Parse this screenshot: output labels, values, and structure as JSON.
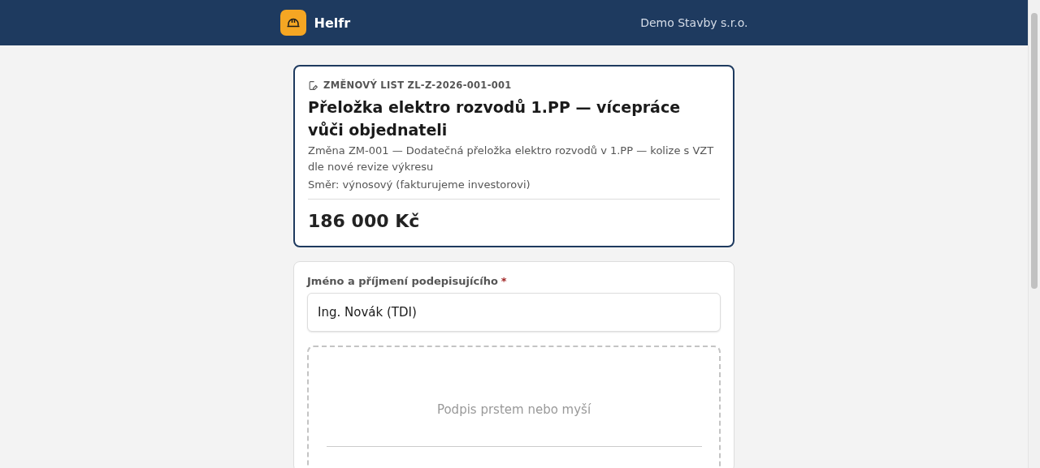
{
  "header": {
    "app_name": "Helfr",
    "company": "Demo Stavby s.r.o."
  },
  "change_card": {
    "eyebrow": "ZMĚNOVÝ LIST ZL-Z-2026-001-001",
    "title": "Přeložka elektro rozvodů 1.PP — vícepráce vůči objednateli",
    "description": "Změna ZM-001 — Dodatečná přeložka elektro rozvodů v 1.PP — kolize s VZT dle nové revize výkresu",
    "direction": "Směr: výnosový (fakturujeme investorovi)",
    "amount": "186 000 Kč"
  },
  "sign_form": {
    "name_label": "Jméno a příjmení podepisujícího",
    "required_mark": "*",
    "name_value": "Ing. Novák (TDI)",
    "signature_placeholder": "Podpis prstem nebo myší"
  }
}
